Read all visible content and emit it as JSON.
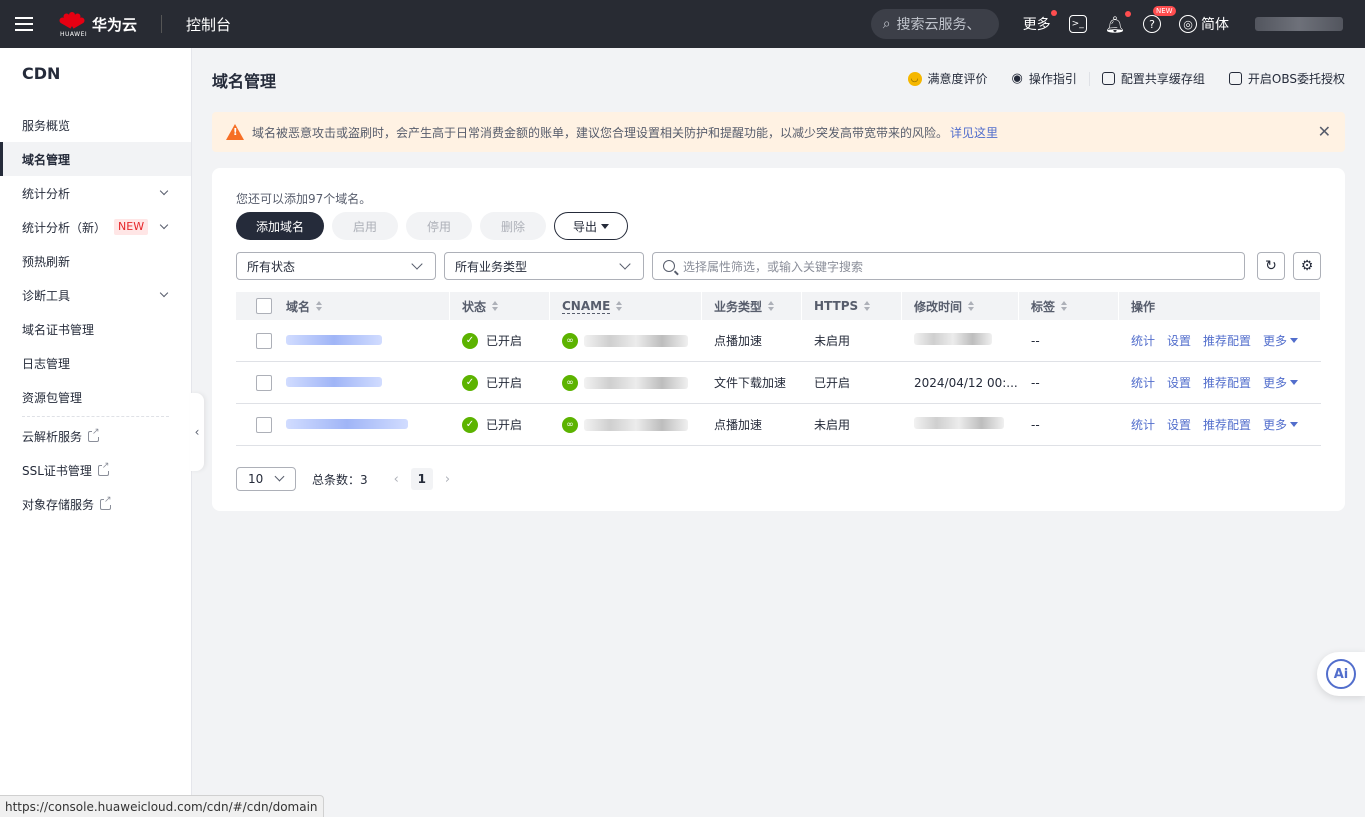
{
  "topbar": {
    "brand_small": "HUAWEI",
    "brand": "华为云",
    "console": "控制台",
    "search_placeholder": "搜索云服务、",
    "more": "更多",
    "new_badge": "NEW",
    "language": "简体"
  },
  "sidebar": {
    "title": "CDN",
    "items": [
      {
        "label": "服务概览"
      },
      {
        "label": "域名管理"
      },
      {
        "label": "统计分析"
      },
      {
        "label": "统计分析（新）",
        "badge": "NEW"
      },
      {
        "label": "预热刷新"
      },
      {
        "label": "诊断工具"
      },
      {
        "label": "域名证书管理"
      },
      {
        "label": "日志管理"
      },
      {
        "label": "资源包管理"
      },
      {
        "label": "云解析服务"
      },
      {
        "label": "SSL证书管理"
      },
      {
        "label": "对象存储服务"
      }
    ]
  },
  "page": {
    "title": "域名管理",
    "header_links": [
      "满意度评价",
      "操作指引",
      "配置共享缓存组",
      "开启OBS委托授权"
    ]
  },
  "alert": {
    "text": "域名被恶意攻击或盗刷时，会产生高于日常消费金额的账单，建议您合理设置相关防护和提醒功能，以减少突发高带宽带来的风险。",
    "link": "详见这里"
  },
  "toolbar": {
    "quota": "您还可以添加97个域名。",
    "add": "添加域名",
    "enable": "启用",
    "disable": "停用",
    "delete": "删除",
    "export": "导出"
  },
  "filters": {
    "status": "所有状态",
    "business_type": "所有业务类型",
    "search_placeholder": "选择属性筛选，或输入关键字搜索"
  },
  "table": {
    "headers": {
      "domain": "域名",
      "status": "状态",
      "cname": "CNAME",
      "business_type": "业务类型",
      "https": "HTTPS",
      "modified": "修改时间",
      "tags": "标签",
      "actions": "操作"
    },
    "rows": [
      {
        "status": "已开启",
        "business_type": "点播加速",
        "https": "未启用",
        "modified": "",
        "tags": "--"
      },
      {
        "status": "已开启",
        "business_type": "文件下载加速",
        "https": "已开启",
        "modified": "2024/04/12 00:...",
        "tags": "--"
      },
      {
        "status": "已开启",
        "business_type": "点播加速",
        "https": "未启用",
        "modified": "",
        "tags": "--"
      }
    ],
    "actions": {
      "stats": "统计",
      "settings": "设置",
      "recommend": "推荐配置",
      "more": "更多"
    }
  },
  "pager": {
    "page_size": "10",
    "total_label": "总条数：",
    "total": "3",
    "current_page": "1"
  },
  "ai_button": "Ai",
  "statusbar": {
    "url": "https://console.huaweicloud.com/cdn/#/cdn/domain"
  }
}
